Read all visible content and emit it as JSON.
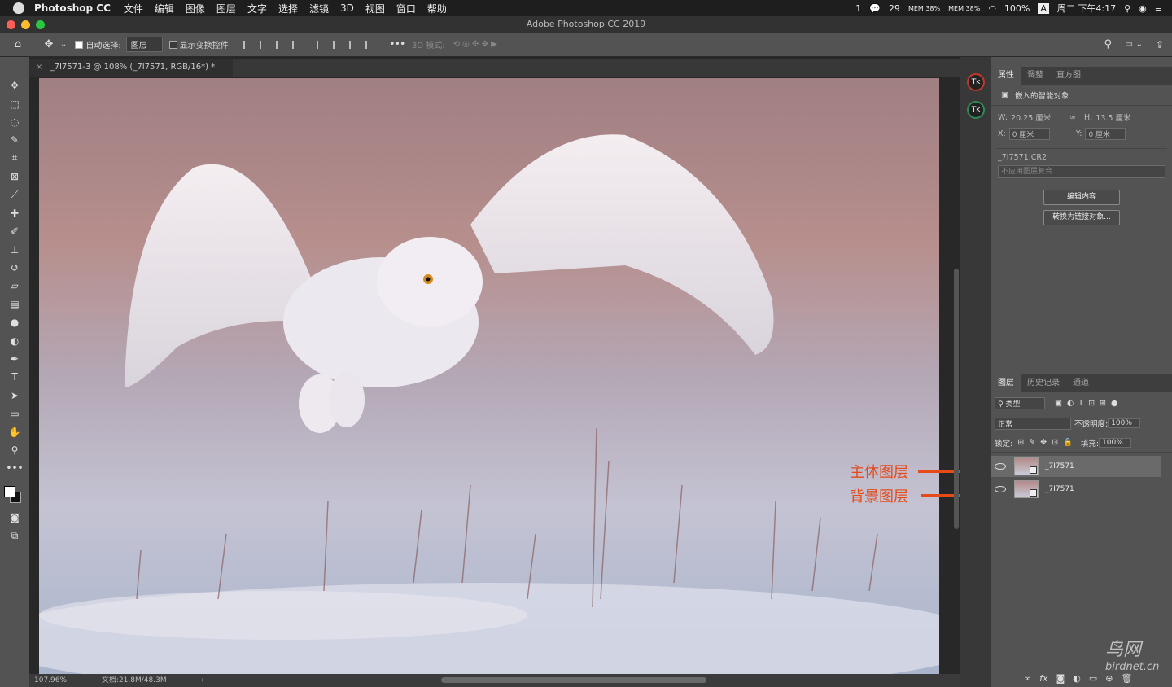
{
  "menubar": {
    "app_name": "Photoshop CC",
    "items": [
      "文件",
      "编辑",
      "图像",
      "图层",
      "文字",
      "选择",
      "滤镜",
      "3D",
      "视图",
      "窗口",
      "帮助"
    ],
    "status": {
      "wechat_count": "29",
      "mem1": "MEM 38%",
      "mem2": "MEM 38%",
      "battery": "100%",
      "input": "A",
      "datetime": "周二 下午4:17",
      "notif": "1"
    }
  },
  "window": {
    "title": "Adobe Photoshop CC 2019"
  },
  "options_bar": {
    "auto_select_label": "自动选择:",
    "auto_select_value": "图层",
    "show_transform_label": "显示变换控件",
    "more": "•••",
    "mode_3d": "3D 模式:"
  },
  "document": {
    "tab_label": "_7I7571-3 @ 108% (_7I7571, RGB/16*) *"
  },
  "status_bar": {
    "zoom": "107.96%",
    "doc_info": "文档:21.8M/48.3M",
    "arrow": "›"
  },
  "tools": [
    {
      "name": "move-tool",
      "glyph": "✥"
    },
    {
      "name": "marquee-tool",
      "glyph": "⬚"
    },
    {
      "name": "lasso-tool",
      "glyph": "◌"
    },
    {
      "name": "quick-select-tool",
      "glyph": "✎"
    },
    {
      "name": "crop-tool",
      "glyph": "⌗"
    },
    {
      "name": "frame-tool",
      "glyph": "⊠"
    },
    {
      "name": "eyedropper-tool",
      "glyph": "⟋"
    },
    {
      "name": "healing-tool",
      "glyph": "✚"
    },
    {
      "name": "brush-tool",
      "glyph": "✐"
    },
    {
      "name": "stamp-tool",
      "glyph": "⊥"
    },
    {
      "name": "history-brush-tool",
      "glyph": "↺"
    },
    {
      "name": "eraser-tool",
      "glyph": "▱"
    },
    {
      "name": "gradient-tool",
      "glyph": "▤"
    },
    {
      "name": "blur-tool",
      "glyph": "●"
    },
    {
      "name": "dodge-tool",
      "glyph": "◐"
    },
    {
      "name": "pen-tool",
      "glyph": "✒"
    },
    {
      "name": "type-tool",
      "glyph": "T"
    },
    {
      "name": "path-select-tool",
      "glyph": "➤"
    },
    {
      "name": "shape-tool",
      "glyph": "▭"
    },
    {
      "name": "hand-tool",
      "glyph": "✋"
    },
    {
      "name": "zoom-tool",
      "glyph": "⚲"
    },
    {
      "name": "more-tools",
      "glyph": "•••"
    }
  ],
  "properties_panel": {
    "tabs": [
      "属性",
      "调整",
      "直方图"
    ],
    "type_label": "嵌入的智能对象",
    "w_label": "W:",
    "w_value": "20.25 厘米",
    "h_label": "H:",
    "h_value": "13.5 厘米",
    "x_label": "X:",
    "x_value": "0 厘米",
    "y_label": "Y:",
    "y_value": "0 厘米",
    "file_name": "_7I7571.CR2",
    "comp_placeholder": "不应用图层复合",
    "edit_button": "编辑内容",
    "convert_button": "转换为链接对象..."
  },
  "layers_panel": {
    "tabs": [
      "图层",
      "历史记录",
      "通道"
    ],
    "filter_label": "类型",
    "blend_mode": "正常",
    "opacity_label": "不透明度:",
    "opacity_value": "100%",
    "lock_label": "锁定:",
    "fill_label": "填充:",
    "fill_value": "100%",
    "layers": [
      {
        "name": "_7I7571",
        "selected": true
      },
      {
        "name": "_7I7571",
        "selected": false
      }
    ],
    "footer_fx": "fx"
  },
  "annotations": {
    "subject_layer": "主体图层",
    "background_layer": "背景图层"
  },
  "watermark": {
    "cn": "鸟网",
    "en": "birdnet.cn"
  },
  "colors": {
    "annotation_red": "#e64a19",
    "panel_bg": "#535353",
    "dark_bg": "#282828"
  }
}
